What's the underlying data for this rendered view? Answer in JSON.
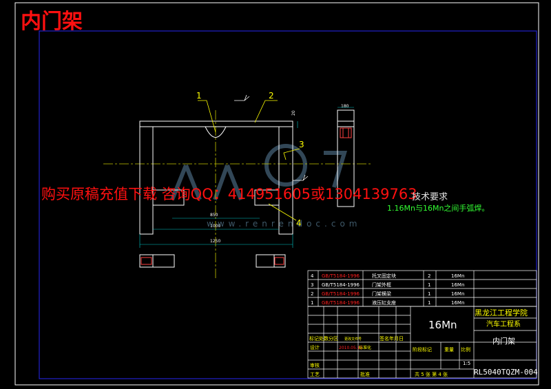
{
  "title": "内门架",
  "ad_text": "购买原稿充值下载 咨询QQ：414951605或1304139763",
  "technical_requirements": {
    "heading": "技术要求",
    "note": "1.16Mn与16Mn之间手弧焊。"
  },
  "watermark": {
    "site": "www.renrendoc.com"
  },
  "callouts": [
    "1",
    "2",
    "3",
    "4"
  ],
  "dimensions": {
    "width_overall": "1250",
    "width_inner": "1000",
    "width_bottom": "850",
    "height_side": "20",
    "top_width": "180"
  },
  "bom": [
    {
      "no": "4",
      "code": "GB/T5184-1996",
      "name": "托叉固定块",
      "qty": "2",
      "material": "16Mn"
    },
    {
      "no": "3",
      "code": "GB/T5184-1996",
      "name": "门架外框",
      "qty": "1",
      "material": "16Mn"
    },
    {
      "no": "2",
      "code": "GB/T5184-1996",
      "name": "门架横梁",
      "qty": "1",
      "material": "16Mn"
    },
    {
      "no": "1",
      "code": "GB/T5184-1996",
      "name": "液压缸支座",
      "qty": "1",
      "material": "16Mn"
    }
  ],
  "title_block": {
    "material": "16Mn",
    "school": "黑龙江工程学院",
    "department": "汽车工程系",
    "drawing_name": "内门架",
    "drawing_no": "RL5040TQZM-004",
    "scale": "1:5",
    "sheets": "共 5 张   第 4 张",
    "labels": {
      "revision": "标记处数分区",
      "change_doc": "更改文件号",
      "signature": "签名年月日",
      "designer": "设计",
      "design_date": "2010.05.12",
      "standardization": "标准化",
      "stage_mark": "阶段标记",
      "weight": "重量",
      "ratio": "比例",
      "checker": "审核",
      "process": "工艺",
      "approve": "批准"
    }
  },
  "colors": {
    "background": "#000000",
    "frame_outer": "#ffffff",
    "frame_inner": "#2222cc",
    "centerline": "#c8c800",
    "leader": "#ffff00",
    "dim": "#00c8c8",
    "title_text": "#ff1010",
    "code_red": "#ff2020",
    "table_text": "#ffffff"
  }
}
